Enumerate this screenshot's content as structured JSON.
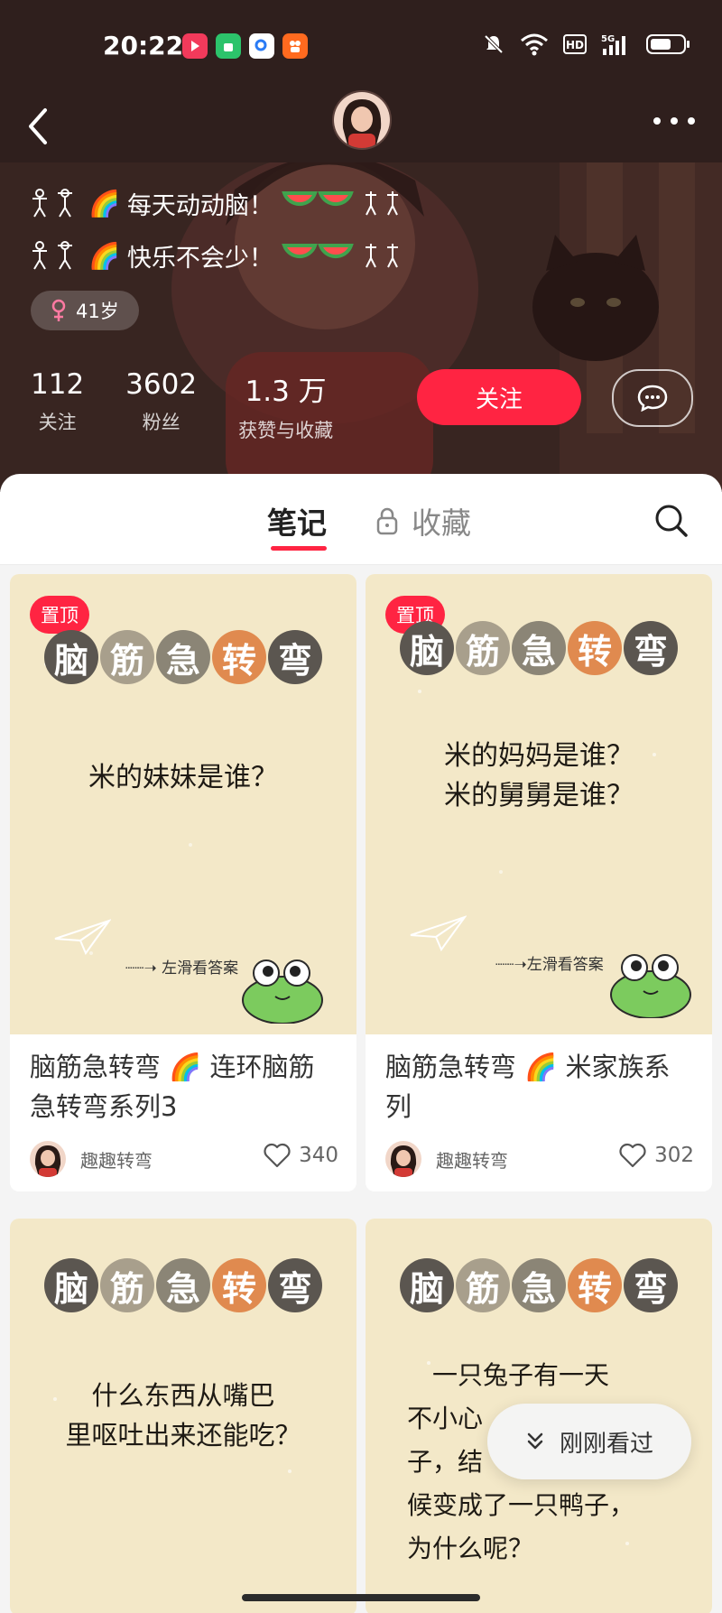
{
  "status_bar": {
    "time": "20:22"
  },
  "profile": {
    "bio_line1": "每天动动脑！",
    "bio_line2": "快乐不会少！",
    "gender_age": "41岁",
    "stats": [
      {
        "num": "112",
        "label": "关注"
      },
      {
        "num": "3602",
        "label": "粉丝"
      },
      {
        "num": "1.3 万",
        "label": "获赞与收藏"
      }
    ],
    "follow_label": "关注"
  },
  "tabs": {
    "notes": "笔记",
    "collect": "收藏"
  },
  "cover_title_chars": [
    "脑",
    "筋",
    "急",
    "转",
    "弯"
  ],
  "cards": [
    {
      "pin": "置顶",
      "riddle": [
        "米的妹妹是谁？"
      ],
      "hint": "左滑看答案",
      "title": "脑筋急转弯 🌈 连环脑筋急转弯系列3",
      "author": "趣趣转弯",
      "likes": "340"
    },
    {
      "pin": "置顶",
      "riddle": [
        "米的妈妈是谁？",
        "米的舅舅是谁？"
      ],
      "hint": "左滑看答案",
      "title": "脑筋急转弯 🌈 米家族系列",
      "author": "趣趣转弯",
      "likes": "302"
    },
    {
      "riddle": [
        "什么东西从嘴巴",
        "里呕吐出来还能吃？"
      ]
    },
    {
      "riddle": [
        "一只兔子有一天",
        "不小心",
        "子，结",
        "候变成了一只鸭子，",
        "为什么呢？"
      ]
    }
  ],
  "recent_label": "刚刚看过",
  "colors": {
    "accent": "#ff2442",
    "cover_bg": "#f3e8c8"
  }
}
